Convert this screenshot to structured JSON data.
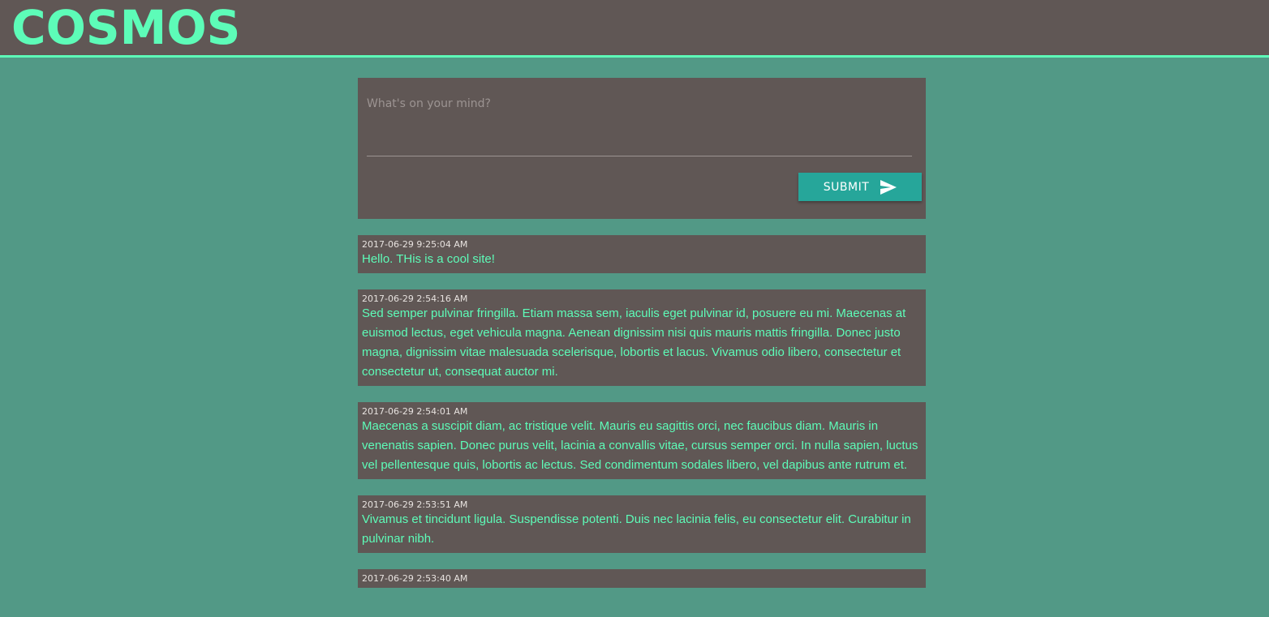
{
  "header": {
    "logo": "COSMOS"
  },
  "composer": {
    "placeholder": "What's on your mind?",
    "submit_label": "SUBMIT",
    "submit_icon": "send-icon"
  },
  "colors": {
    "background": "#529986",
    "panel": "#605755",
    "accent": "#5dfcb8",
    "button": "#26a69a"
  },
  "posts": [
    {
      "time": "2017-06-29 9:25:04 AM",
      "text": "Hello. THis is a cool site!"
    },
    {
      "time": "2017-06-29 2:54:16 AM",
      "text": "Sed semper pulvinar fringilla. Etiam massa sem, iaculis eget pulvinar id, posuere eu mi. Maecenas at euismod lectus, eget vehicula magna. Aenean dignissim nisi quis mauris mattis fringilla. Donec justo magna, dignissim vitae malesuada scelerisque, lobortis et lacus. Vivamus odio libero, consectetur et consectetur ut, consequat auctor mi."
    },
    {
      "time": "2017-06-29 2:54:01 AM",
      "text": "Maecenas a suscipit diam, ac tristique velit. Mauris eu sagittis orci, nec faucibus diam. Mauris in venenatis sapien. Donec purus velit, lacinia a convallis vitae, cursus semper orci. In nulla sapien, luctus vel pellentesque quis, lobortis ac lectus. Sed condimentum sodales libero, vel dapibus ante rutrum et."
    },
    {
      "time": "2017-06-29 2:53:51 AM",
      "text": "Vivamus et tincidunt ligula. Suspendisse potenti. Duis nec lacinia felis, eu consectetur elit. Curabitur in pulvinar nibh."
    },
    {
      "time": "2017-06-29 2:53:40 AM",
      "text": ""
    }
  ]
}
